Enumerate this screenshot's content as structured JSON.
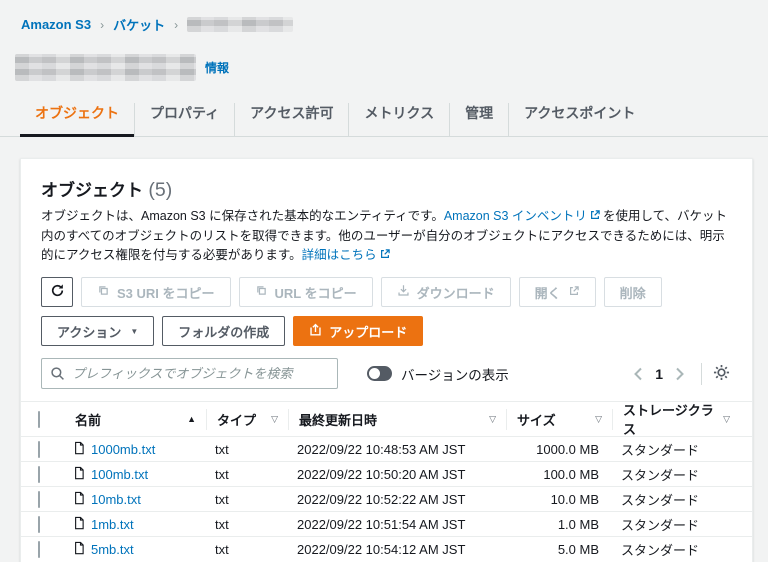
{
  "breadcrumb": {
    "home": "Amazon S3",
    "buckets": "バケット",
    "separator": "›"
  },
  "page": {
    "info_label": "情報"
  },
  "tabs": [
    {
      "label": "オブジェクト"
    },
    {
      "label": "プロパティ"
    },
    {
      "label": "アクセス許可"
    },
    {
      "label": "メトリクス"
    },
    {
      "label": "管理"
    },
    {
      "label": "アクセスポイント"
    }
  ],
  "objects_panel": {
    "title": "オブジェクト",
    "count": "(5)",
    "desc_1": "オブジェクトは、Amazon S3 に保存された基本的なエンティティです。",
    "desc_link_1": "Amazon S3 インベントリ",
    "desc_2": "を使用して、バケット内のすべてのオブジェクトのリストを取得できます。他のユーザーが自分のオブジェクトにアクセスできるためには、明示的にアクセス権限を付与する必要があります。",
    "desc_link_2": "詳細はこちら",
    "buttons": {
      "copy_s3_uri": "S3 URI をコピー",
      "copy_url": "URL をコピー",
      "download": "ダウンロード",
      "open": "開く",
      "delete": "削除",
      "actions": "アクション",
      "create_folder": "フォルダの作成",
      "upload": "アップロード"
    },
    "search_placeholder": "プレフィックスでオブジェクトを検索",
    "toggle_label": "バージョンの表示",
    "pagination": {
      "page": "1"
    }
  },
  "table": {
    "columns": {
      "name": "名前",
      "type": "タイプ",
      "modified": "最終更新日時",
      "size": "サイズ",
      "storage": "ストレージクラス"
    },
    "rows": [
      {
        "name": "1000mb.txt",
        "type": "txt",
        "modified": "2022/09/22 10:48:53 AM JST",
        "size": "1000.0 MB",
        "storage_class": "スタンダード"
      },
      {
        "name": "100mb.txt",
        "type": "txt",
        "modified": "2022/09/22 10:50:20 AM JST",
        "size": "100.0 MB",
        "storage_class": "スタンダード"
      },
      {
        "name": "10mb.txt",
        "type": "txt",
        "modified": "2022/09/22 10:52:22 AM JST",
        "size": "10.0 MB",
        "storage_class": "スタンダード"
      },
      {
        "name": "1mb.txt",
        "type": "txt",
        "modified": "2022/09/22 10:51:54 AM JST",
        "size": "1.0 MB",
        "storage_class": "スタンダード"
      },
      {
        "name": "5mb.txt",
        "type": "txt",
        "modified": "2022/09/22 10:54:12 AM JST",
        "size": "5.0 MB",
        "storage_class": "スタンダード"
      }
    ]
  },
  "colors": {
    "accent_orange": "#ec7211",
    "link_blue": "#0073bb",
    "text_dark": "#16191f"
  }
}
